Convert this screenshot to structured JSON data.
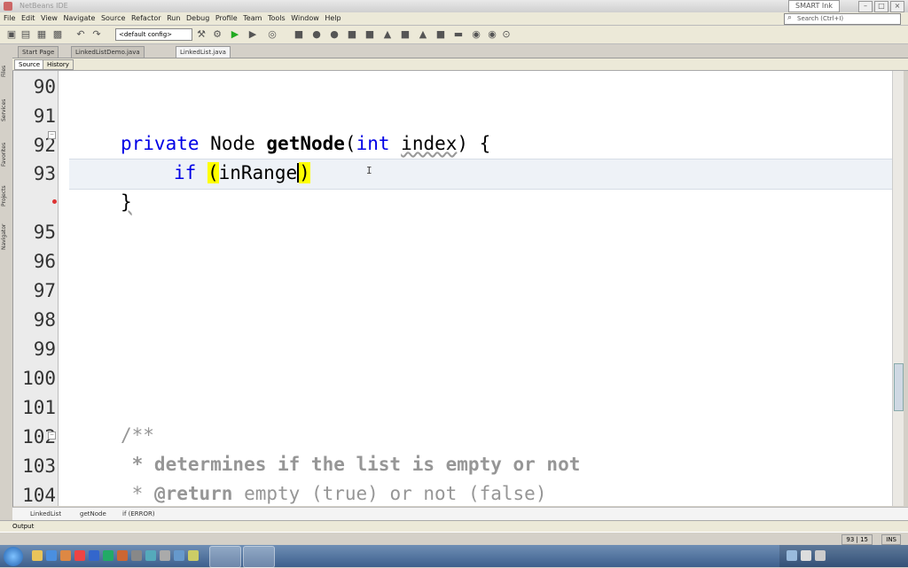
{
  "window": {
    "title": "NetBeans IDE"
  },
  "smart_ink": "SMART Ink",
  "menu": [
    "File",
    "Edit",
    "View",
    "Navigate",
    "Source",
    "Refactor",
    "Run",
    "Debug",
    "Profile",
    "Team",
    "Tools",
    "Window",
    "Help"
  ],
  "search": {
    "placeholder": "Search (Ctrl+I)"
  },
  "toolbar": {
    "config": "<default config>"
  },
  "file_tabs": [
    "Start Page",
    "LinkedListDemo.java",
    "LinkedList.java"
  ],
  "editor_tabs": {
    "source": "Source",
    "history": "History"
  },
  "sidebar": [
    "Files",
    "Services",
    "Favorites",
    "Projects",
    "Navigator"
  ],
  "code_lines": [
    {
      "num": "90"
    },
    {
      "num": "91"
    },
    {
      "num": "92",
      "mod": "private",
      "type": "Node",
      "method": "getNode",
      "params_open": "(",
      "ptype": "int",
      "pname": "index",
      "rest": ") {"
    },
    {
      "num": "93",
      "kw": "if",
      "open": "(",
      "ident": "inRange",
      "close": ")"
    },
    {
      "num": "",
      "brace": "}"
    },
    {
      "num": "95"
    },
    {
      "num": "96"
    },
    {
      "num": "97"
    },
    {
      "num": "98"
    },
    {
      "num": "99"
    },
    {
      "num": "100"
    },
    {
      "num": "101"
    },
    {
      "num": "102",
      "comment": "/**"
    },
    {
      "num": "103",
      "comment": " * determines if the list is empty or not"
    },
    {
      "num": "104",
      "tag": "@return",
      "comment_rest": " empty (true) or not (false)"
    }
  ],
  "breadcrumbs": [
    "LinkedList",
    "getNode",
    "if (ERROR)"
  ],
  "output_label": "Output",
  "status": {
    "position": "93 | 15",
    "mode": "INS"
  },
  "colors": {
    "keyword": "#0000e6",
    "comment": "#969696",
    "match_highlight": "#ffff00",
    "current_line": "#eef2f7"
  }
}
